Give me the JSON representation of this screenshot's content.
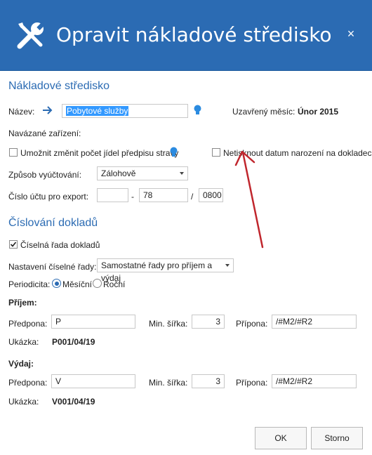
{
  "header": {
    "title": "Opravit nákladové středisko",
    "close": "×"
  },
  "cost_center": {
    "section_title": "Nákladové středisko",
    "name_label": "Název:",
    "name_value": "Pobytové služby",
    "closed_month_label": "Uzavřený měsíc:",
    "closed_month_value": "Únor 2015",
    "linked_devices_label": "Navázané zařízení:",
    "allow_change_label": "Umožnit změnit počet jídel předpisu stravy",
    "no_print_birth_label": "Netisknout datum narození na dokladech",
    "billing_label": "Způsob vyúčtování:",
    "billing_value": "Zálohově",
    "account_label": "Číslo účtu pro export:",
    "account_prefix": "",
    "account_dash": "-",
    "account_number": "78",
    "account_slash": "/",
    "account_bank": "0800"
  },
  "numbering": {
    "section_title": "Číslování dokladů",
    "series_label": "Číselná řada dokladů",
    "setting_label": "Nastavení číselné řady:",
    "setting_value": "Samostatné řady pro příjem a výdaj",
    "periodicity_label": "Periodicita:",
    "monthly_label": "Měsíční",
    "yearly_label": "Roční",
    "income": {
      "title": "Příjem:",
      "prefix_label": "Předpona:",
      "prefix_value": "P",
      "min_width_label": "Min. šířka:",
      "min_width_value": "3",
      "suffix_label": "Přípona:",
      "suffix_value": "/#M2/#R2",
      "sample_label": "Ukázka:",
      "sample_value": "P001/04/19"
    },
    "expense": {
      "title": "Výdaj:",
      "prefix_label": "Předpona:",
      "prefix_value": "V",
      "min_width_label": "Min. šířka:",
      "min_width_value": "3",
      "suffix_label": "Přípona:",
      "suffix_value": "/#M2/#R2",
      "sample_label": "Ukázka:",
      "sample_value": "V001/04/19"
    }
  },
  "buttons": {
    "ok": "OK",
    "cancel": "Storno"
  },
  "colors": {
    "accent": "#2b6bb3",
    "arrow": "#c0262d",
    "selection": "#3399ff"
  }
}
